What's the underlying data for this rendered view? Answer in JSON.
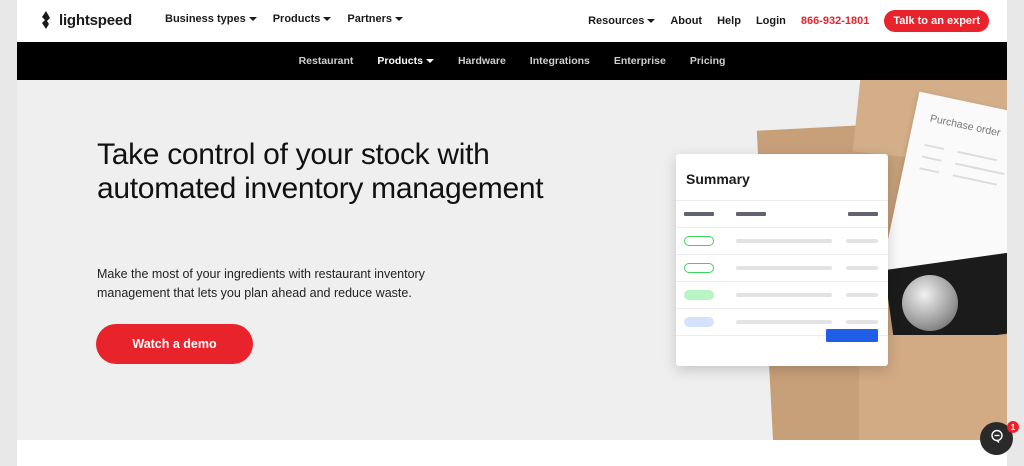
{
  "brand": {
    "name": "lightspeed"
  },
  "topnav": {
    "left_items": [
      {
        "label": "Business types"
      },
      {
        "label": "Products"
      },
      {
        "label": "Partners"
      }
    ],
    "resources": "Resources",
    "about": "About",
    "help": "Help",
    "login": "Login",
    "phone": "866-932-1801",
    "cta": "Talk to an expert"
  },
  "subnav": {
    "items": [
      {
        "label": "Restaurant"
      },
      {
        "label": "Products"
      },
      {
        "label": "Hardware"
      },
      {
        "label": "Integrations"
      },
      {
        "label": "Enterprise"
      },
      {
        "label": "Pricing"
      }
    ]
  },
  "hero": {
    "title": "Take control of your stock with automated inventory management",
    "description": "Make the most of your ingredients with restaurant inventory management that lets you plan ahead and reduce waste.",
    "cta": "Watch a demo"
  },
  "illustration": {
    "summary_title": "Summary",
    "purchase_label": "Purchase order",
    "pill_colors": [
      "#ffffff",
      "#ffffff",
      "#b7f5c4",
      "#d6e2fb"
    ],
    "pill_borders": [
      "#3fd35e",
      "#3fd35e",
      "#b7f5c4",
      "#d6e2fb"
    ]
  },
  "chat": {
    "badge": "1"
  },
  "colors": {
    "accent": "#e8232b",
    "nav_bg": "#000000",
    "hero_bg": "#efefef",
    "button_blue": "#1f5ee6"
  }
}
